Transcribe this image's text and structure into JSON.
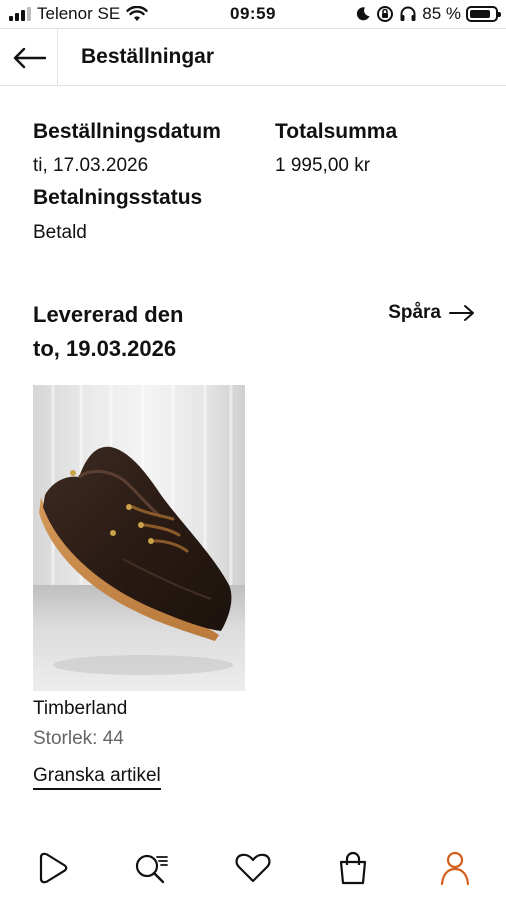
{
  "status_bar": {
    "carrier": "Telenor SE",
    "time": "09:59",
    "battery": "85 %",
    "battery_level": 0.85
  },
  "header": {
    "title": "Beställningar",
    "back_icon": "arrow-left-icon"
  },
  "order": {
    "date_label": "Beställningsdatum",
    "date_value": "ti, 17.03.2026",
    "total_label": "Totalsumma",
    "total_value": "1 995,00 kr",
    "payment_label": "Betalningsstatus",
    "payment_value": "Betald"
  },
  "delivery": {
    "line1": "Levererad den",
    "line2": "to, 19.03.2026",
    "track_label": "Spåra"
  },
  "product": {
    "brand": "Timberland",
    "size": "Storlek: 44",
    "review_label": "Granska artikel"
  },
  "bottom_nav": {
    "items": [
      {
        "icon": "play-icon"
      },
      {
        "icon": "search-list-icon"
      },
      {
        "icon": "heart-icon"
      },
      {
        "icon": "bag-icon"
      },
      {
        "icon": "profile-icon",
        "active": true
      }
    ],
    "active_color": "#d35f1c"
  }
}
